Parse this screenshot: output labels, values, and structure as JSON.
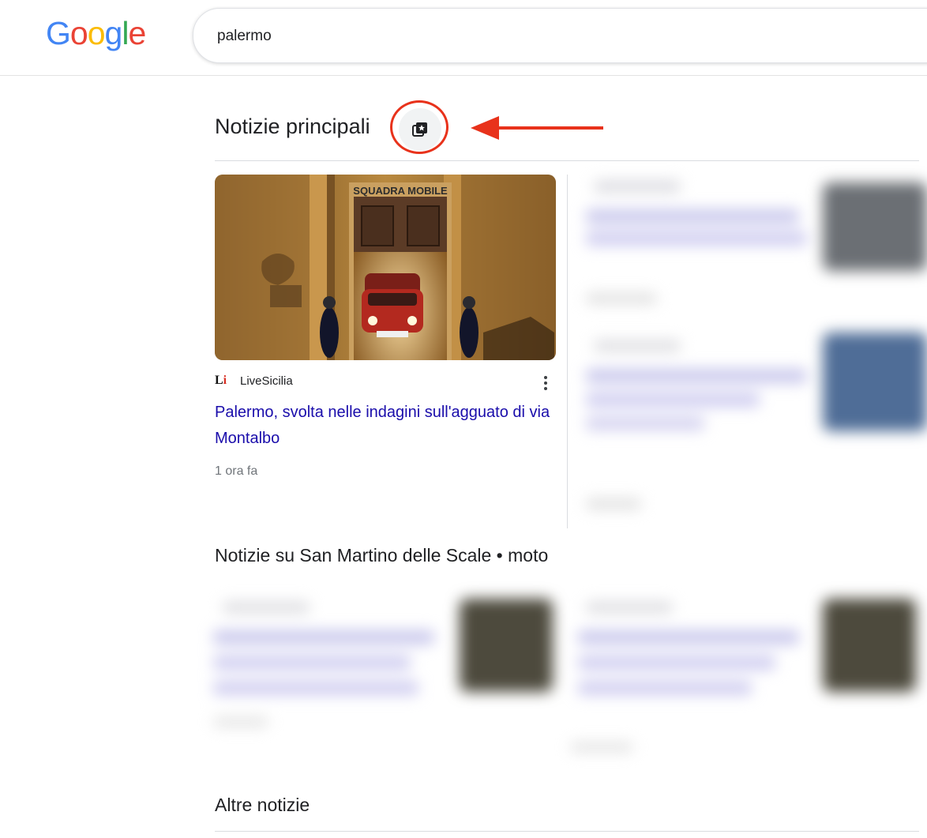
{
  "logo": {
    "text": "Google",
    "letters": [
      {
        "ch": "G",
        "color": "#4285F4"
      },
      {
        "ch": "o",
        "color": "#EA4335"
      },
      {
        "ch": "o",
        "color": "#FBBC05"
      },
      {
        "ch": "g",
        "color": "#4285F4"
      },
      {
        "ch": "l",
        "color": "#34A853"
      },
      {
        "ch": "e",
        "color": "#EA4335"
      }
    ]
  },
  "search": {
    "value": "palermo"
  },
  "top_news": {
    "title": "Notizie principali",
    "icon": "news-collection-star-icon",
    "annotation_color": "#e8321b",
    "story": {
      "source_logo": "LiveSicilia-logo",
      "source": "LiveSicilia",
      "headline": "Palermo, svolta nelle indagini sull'agguato di via Montalbo",
      "time": "1 ora fa",
      "image_sign": "SQUADRA MOBILE"
    }
  },
  "topic_news": {
    "title": "Notizie su San Martino delle Scale • moto"
  },
  "more_news": {
    "title": "Altre notizie"
  },
  "colors": {
    "link": "#1a0dab",
    "meta": "#70757a",
    "divider": "#dadce0"
  }
}
